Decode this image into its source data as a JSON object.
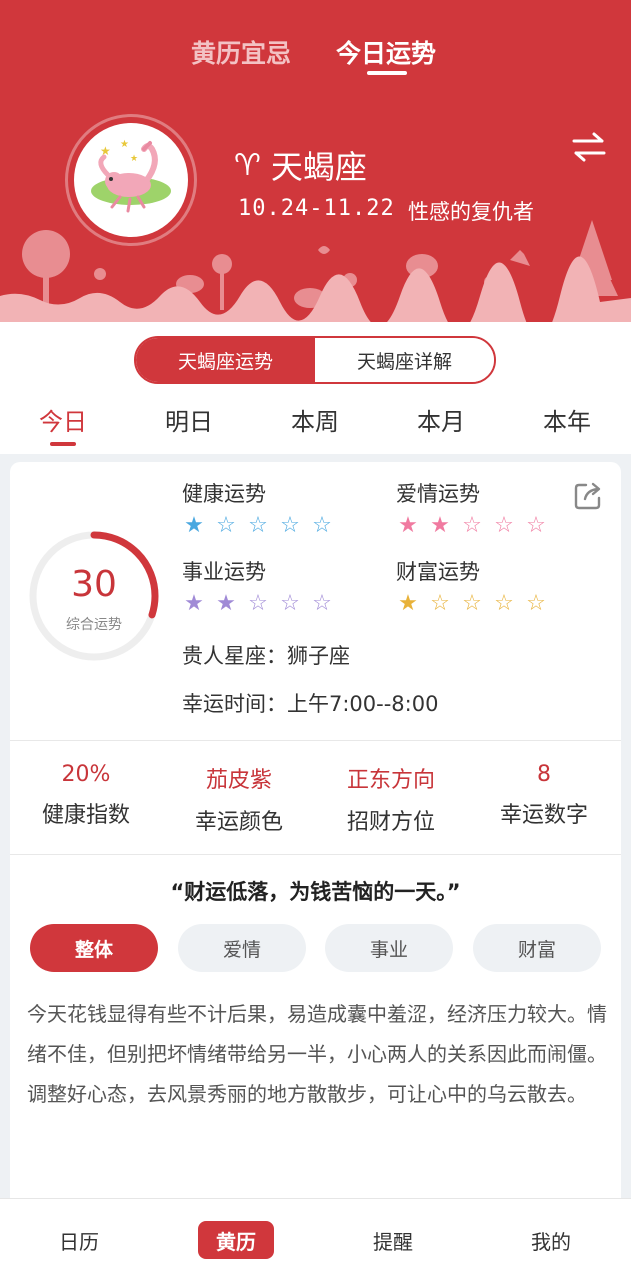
{
  "header": {
    "tabs": [
      {
        "label": "黄历宜忌"
      },
      {
        "label": "今日运势"
      }
    ],
    "sign": {
      "glyph": "♈",
      "name": "天蝎座",
      "dates": "10.24-11.22",
      "motto": "性感的复仇者"
    }
  },
  "segment": {
    "options": [
      "天蝎座运势",
      "天蝎座详解"
    ]
  },
  "periods": [
    "今日",
    "明日",
    "本周",
    "本月",
    "本年"
  ],
  "score": {
    "value": 30,
    "label": "综合运势",
    "fraction": 0.3
  },
  "fortunes": [
    {
      "label": "健康运势",
      "stars": 1,
      "color": "#4aa8e0"
    },
    {
      "label": "爱情运势",
      "stars": 2,
      "color": "#f07aa0"
    },
    {
      "label": "事业运势",
      "stars": 2,
      "color": "#a08ad6"
    },
    {
      "label": "财富运势",
      "stars": 1,
      "color": "#e8b23a"
    }
  ],
  "noble_sign": "贵人星座：狮子座",
  "lucky_time": "幸运时间：上午7:00--8:00",
  "stats": [
    {
      "value": "20%",
      "label": "健康指数"
    },
    {
      "value": "茄皮紫",
      "label": "幸运颜色"
    },
    {
      "value": "正东方向",
      "label": "招财方位"
    },
    {
      "value": "8",
      "label": "幸运数字"
    }
  ],
  "quote": "“财运低落，为钱苦恼的一天。”",
  "fortune_tabs": [
    "整体",
    "爱情",
    "事业",
    "财富"
  ],
  "description": "今天花钱显得有些不计后果，易造成囊中羞涩，经济压力较大。情绪不佳，但别把坏情绪带给另一半，小心两人的关系因此而闹僵。调整好心态，去风景秀丽的地方散散步，可让心中的乌云散去。",
  "bottom_nav": [
    {
      "label": "日历"
    },
    {
      "label": "黄历"
    },
    {
      "label": "提醒"
    },
    {
      "label": "我的"
    }
  ],
  "colors": {
    "brand": "#d0373c",
    "bg": "#eef1f4"
  }
}
